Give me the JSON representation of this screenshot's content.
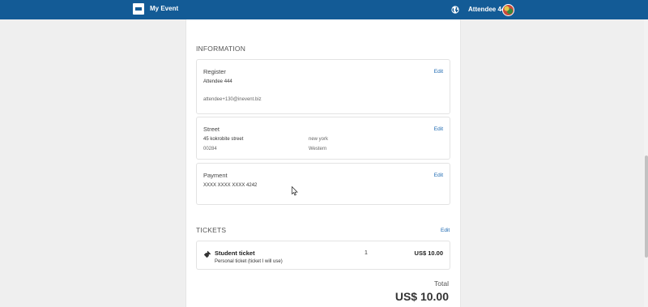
{
  "header": {
    "app_title": "My Event",
    "user_name": "Attendee 444",
    "icons": [
      "logo-icon",
      "globe-icon",
      "avatar"
    ]
  },
  "information": {
    "heading": "INFORMATION",
    "register": {
      "title": "Register",
      "edit_label": "Edit",
      "name": "Attendee 444",
      "email": "attendee+130@inevent.biz"
    },
    "street": {
      "title": "Street",
      "edit_label": "Edit",
      "line1": "45 kokrobite street",
      "postcode": "00284",
      "city": "new york",
      "region": "Western"
    },
    "payment": {
      "title": "Payment",
      "edit_label": "Edit",
      "card_number": "XXXX XXXX XXXX 4242"
    }
  },
  "tickets": {
    "heading": "TICKETS",
    "edit_label": "Edit",
    "items": [
      {
        "name": "Student ticket",
        "description": "Personal ticket (ticket I will use)",
        "quantity": "1",
        "price": "US$ 10.00"
      }
    ],
    "total_label": "Total",
    "total_value": "US$ 10.00"
  },
  "colors": {
    "header_bg": "#135b96",
    "link": "#1a67b0",
    "page_bg": "#efefef"
  }
}
